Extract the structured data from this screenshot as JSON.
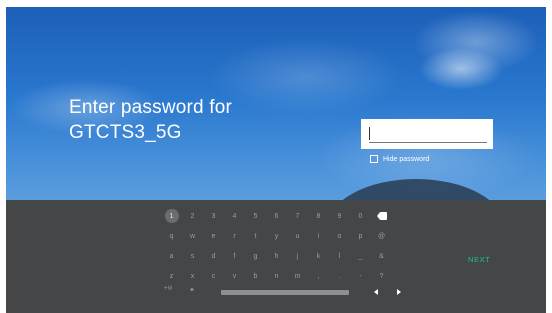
{
  "prompt": {
    "line1": "Enter password for",
    "line2": "GTCTS3_5G"
  },
  "password_field": {
    "value": ""
  },
  "hide_password": {
    "label": "Hide password",
    "checked": false
  },
  "keyboard": {
    "row1": [
      "1",
      "2",
      "3",
      "4",
      "5",
      "6",
      "7",
      "8",
      "9",
      "0"
    ],
    "row2": [
      "q",
      "w",
      "e",
      "r",
      "t",
      "y",
      "u",
      "i",
      "o",
      "p",
      "@"
    ],
    "row3": [
      "a",
      "s",
      "d",
      "f",
      "g",
      "h",
      "j",
      "k",
      "l",
      "_",
      "&"
    ],
    "row4": [
      "z",
      "x",
      "c",
      "v",
      "b",
      "n",
      "m",
      ",",
      ".",
      "-",
      "?"
    ],
    "symbols_label": "+!#",
    "settings_glyph": "✦",
    "next_label": "NEXT"
  },
  "colors": {
    "keyboard_bg": "#444648",
    "next_accent": "#1fbf9a"
  }
}
